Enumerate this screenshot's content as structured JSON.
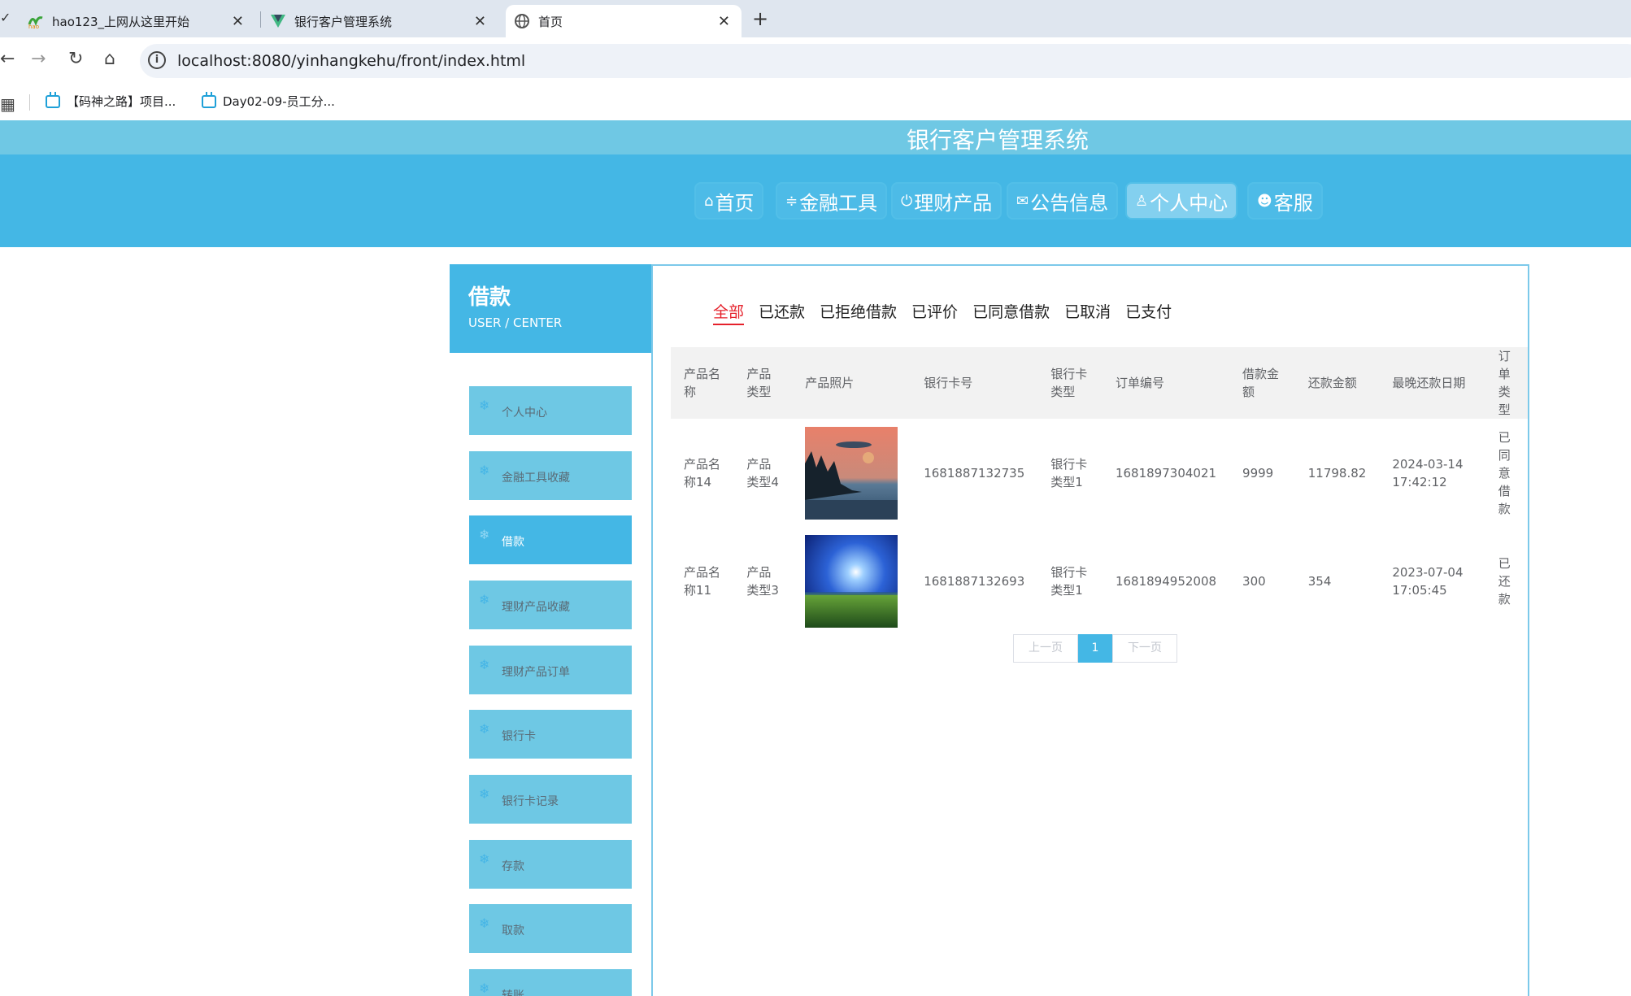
{
  "browser": {
    "tabs": [
      {
        "title": "hao123_上网从这里开始"
      },
      {
        "title": "银行客户管理系统"
      },
      {
        "title": "首页"
      }
    ],
    "url": "localhost:8080/yinhangkehu/front/index.html",
    "bookmarks": [
      {
        "label": "【码神之路】项目..."
      },
      {
        "label": "Day02-09-员工分..."
      }
    ]
  },
  "site": {
    "title": "银行客户管理系统",
    "nav": [
      {
        "label": "首页",
        "icon": "home-icon"
      },
      {
        "label": "金融工具",
        "icon": "sliders-icon"
      },
      {
        "label": "理财产品",
        "icon": "power-icon"
      },
      {
        "label": "公告信息",
        "icon": "mail-icon"
      },
      {
        "label": "个人中心",
        "icon": "user-icon",
        "active": true
      },
      {
        "label": "客服",
        "icon": "chat-icon"
      }
    ]
  },
  "sidebar": {
    "title": "借款",
    "subtitle": "USER / CENTER",
    "items": [
      {
        "label": "个人中心"
      },
      {
        "label": "金融工具收藏"
      },
      {
        "label": "借款",
        "active": true
      },
      {
        "label": "理财产品收藏"
      },
      {
        "label": "理财产品订单"
      },
      {
        "label": "银行卡"
      },
      {
        "label": "银行卡记录"
      },
      {
        "label": "存款"
      },
      {
        "label": "取款"
      },
      {
        "label": "转账"
      }
    ]
  },
  "filters": [
    {
      "label": "全部",
      "active": true
    },
    {
      "label": "已还款"
    },
    {
      "label": "已拒绝借款"
    },
    {
      "label": "已评价"
    },
    {
      "label": "已同意借款"
    },
    {
      "label": "已取消"
    },
    {
      "label": "已支付"
    }
  ],
  "table": {
    "headers": [
      "产品名称",
      "产品类型",
      "产品照片",
      "银行卡号",
      "银行卡类型",
      "订单编号",
      "借款金额",
      "还款金额",
      "最晚还款日期",
      "订单类型"
    ],
    "rows": [
      {
        "name": "产品名称14",
        "type": "产品类型4",
        "photo": "sunset-lake",
        "card": "1681887132735",
        "card_type": "银行卡类型1",
        "order_no": "1681897304021",
        "loan": "9999",
        "repay": "11798.82",
        "deadline": "2024-03-14 17:42:12",
        "status": "已同意借款"
      },
      {
        "name": "产品名称11",
        "type": "产品类型3",
        "photo": "night-meadow",
        "card": "1681887132693",
        "card_type": "银行卡类型1",
        "order_no": "1681894952008",
        "loan": "300",
        "repay": "354",
        "deadline": "2023-07-04 17:05:45",
        "status": "已还款"
      }
    ]
  },
  "pager": {
    "prev": "上一页",
    "current": "1",
    "next": "下一页"
  },
  "colors": {
    "primary": "#44b7e5",
    "light": "#6ec8e4",
    "active_filter": "#e5212b"
  }
}
